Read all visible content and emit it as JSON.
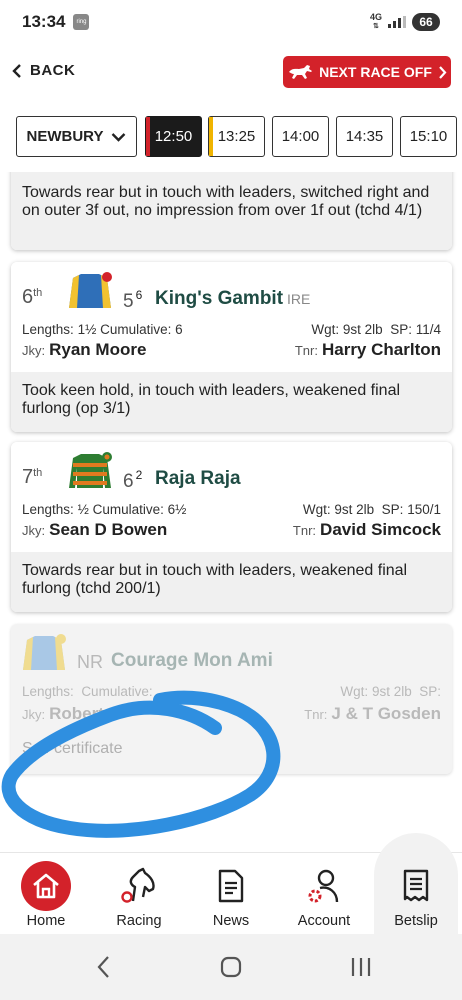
{
  "status_bar": {
    "time": "13:34",
    "notification": "ring",
    "network": "4G",
    "battery": "66"
  },
  "header": {
    "back_label": "BACK",
    "next_race_label": "NEXT RACE OFF"
  },
  "race_bar": {
    "course": "NEWBURY",
    "times": [
      {
        "label": "12:50",
        "active": true,
        "accent": "#d3222a"
      },
      {
        "label": "13:25",
        "active": false,
        "accent": "#f0b400"
      },
      {
        "label": "14:00",
        "active": false,
        "accent": ""
      },
      {
        "label": "14:35",
        "active": false,
        "accent": ""
      },
      {
        "label": "15:10",
        "active": false,
        "accent": ""
      }
    ]
  },
  "cards": {
    "partial": {
      "comment": "Towards rear but in touch with leaders, switched right and on outer 3f out, no impression from over 1f out (tchd 4/1)"
    },
    "sixth": {
      "position": "6",
      "position_suffix": "th",
      "number": "5",
      "draw": "6",
      "horse": "King's Gambit",
      "country": "IRE",
      "lengths_label": "Lengths:",
      "lengths": "1½",
      "cumulative_label": "Cumulative:",
      "cumulative": "6",
      "weight_label": "Wgt:",
      "weight": "9st 2lb",
      "sp_label": "SP:",
      "sp": "11/4",
      "jockey_label": "Jky:",
      "jockey": "Ryan Moore",
      "trainer_label": "Tnr:",
      "trainer": "Harry Charlton",
      "comment": "Took keen hold, in touch with leaders, weakened final furlong (op 3/1)",
      "silks": "blue-yellow-red-cap"
    },
    "seventh": {
      "position": "7",
      "position_suffix": "th",
      "number": "6",
      "draw": "2",
      "horse": "Raja Raja",
      "lengths_label": "Lengths:",
      "lengths": "½",
      "cumulative_label": "Cumulative:",
      "cumulative": "6½",
      "weight_label": "Wgt:",
      "weight": "9st 2lb",
      "sp_label": "SP:",
      "sp": "150/1",
      "jockey_label": "Jky:",
      "jockey": "Sean D Bowen",
      "trainer_label": "Tnr:",
      "trainer": "David Simcock",
      "comment": "Towards rear but in touch with leaders, weakened final furlong (tchd 200/1)",
      "silks": "green-orange-hoops"
    },
    "nonrunner": {
      "status": "NR",
      "horse": "Courage Mon Ami",
      "lengths_label": "Lengths:",
      "cumulative_label": "Cumulative:",
      "weight_label": "Wgt:",
      "weight": "9st 2lb",
      "sp_label": "SP:",
      "jockey_label": "Jky:",
      "jockey": "Robert H",
      "trainer_label": "Tnr:",
      "trainer": "J & T Gosden",
      "comment": "Self certificate",
      "silks": "light-blue-yellow"
    }
  },
  "bottom_nav": {
    "home": "Home",
    "racing": "Racing",
    "news": "News",
    "account": "Account",
    "betslip": "Betslip"
  },
  "colors": {
    "brand_red": "#d3222a",
    "horse_name": "#1f4c44",
    "scribble": "#2f8fe0"
  }
}
